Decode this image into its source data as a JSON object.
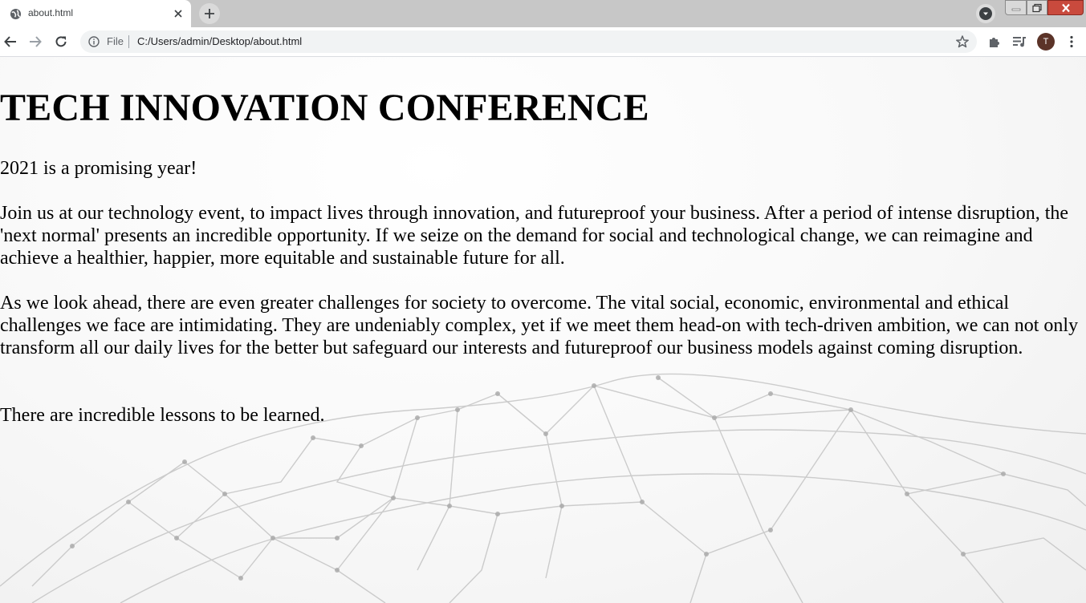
{
  "browser": {
    "tab": {
      "title": "about.html",
      "favicon": "globe-icon",
      "close_icon": "close-icon"
    },
    "new_tab_icon": "plus-icon",
    "tab_search_icon": "chevron-down-icon",
    "window_controls": [
      "minimize-icon",
      "maximize-icon",
      "close-icon"
    ],
    "nav": {
      "back_icon": "arrow-left-icon",
      "forward_icon": "arrow-right-icon",
      "reload_icon": "reload-icon"
    },
    "omnibox": {
      "info_icon": "info-icon",
      "scheme_chip": "File",
      "url": "C:/Users/admin/Desktop/about.html",
      "star_icon": "star-icon"
    },
    "toolbar_icons": [
      "puzzle-icon",
      "playlist-icon",
      "more-vert-icon"
    ],
    "profile_initial": "T",
    "colors": {
      "tabstrip": "#c7c7c7",
      "close_button": "#c94a3d",
      "avatar": "#5b3328"
    }
  },
  "page": {
    "heading": "TECH INNOVATION CONFERENCE",
    "paragraphs": [
      "2021 is a promising year!",
      "Join us at our technology event, to impact lives through innovation, and futureproof your business. After a period of intense disruption, the 'next normal' presents an incredible opportunity. If we seize on the demand for social and technological change, we can reimagine and achieve a healthier, happier, more equitable and sustainable future for all.",
      "As we look ahead, there are even greater challenges for society to overcome. The vital social, economic, environmental and ethical challenges we face are intimidating. They are undeniably complex, yet if we meet them head-on with tech-driven ambition, we can not only transform all our daily lives for the better but safeguard our interests and futureproof our business models against coming disruption.",
      "There are incredible lessons to be learned."
    ],
    "background_image": "network-mesh-image"
  }
}
